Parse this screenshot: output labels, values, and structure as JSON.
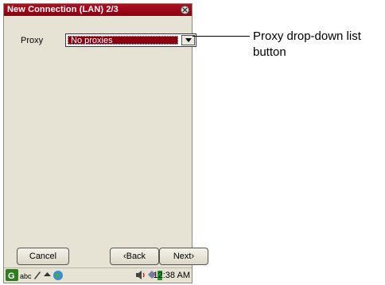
{
  "window": {
    "title": "New Connection (LAN) 2/3"
  },
  "form": {
    "proxy_label": "Proxy",
    "proxy_value": "No proxies"
  },
  "buttons": {
    "cancel": "Cancel",
    "back": "‹Back",
    "next": "Next›"
  },
  "taskbar": {
    "abc": "abc",
    "time": "12:38 AM"
  },
  "callout": {
    "text": "Proxy drop-down list button"
  },
  "colors": {
    "titlebar": "#a00018",
    "background": "#e6e3d4",
    "selection": "#8a0010"
  },
  "icons": [
    "close-icon",
    "dropdown-arrow-icon",
    "start-icon",
    "pen-icon",
    "up-arrow-icon",
    "globe-icon",
    "speaker-icon",
    "network-icon",
    "battery-icon"
  ]
}
